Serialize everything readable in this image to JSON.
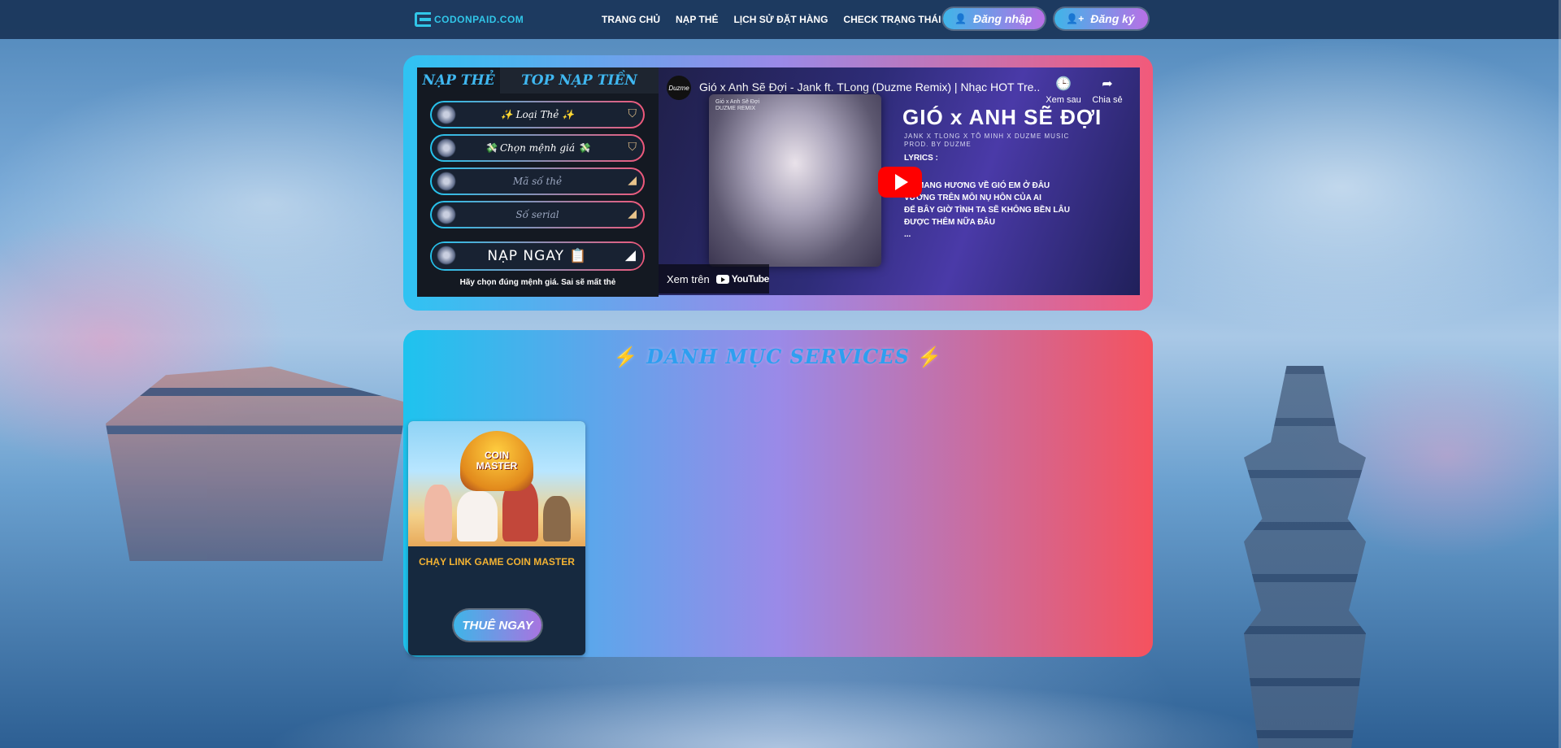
{
  "brand": {
    "logo_text": "CODONPAID.COM"
  },
  "nav": {
    "links": [
      "TRANG CHỦ",
      "NẠP THẺ",
      "LỊCH SỬ ĐẶT HÀNG",
      "CHECK TRẠNG THÁI LINK"
    ],
    "login_label": "Đăng nhập",
    "register_label": "Đăng ký"
  },
  "topup": {
    "tabs": [
      "NẠP THẺ",
      "TOP NẠP TIỀN"
    ],
    "card_type": "✨ Loại Thẻ ✨",
    "amount": "💸 Chọn mệnh giá 💸",
    "code_placeholder": "Mã số thẻ",
    "serial_placeholder": "Số serial",
    "submit_label": "NẠP NGAY 📋",
    "note": "Hãy chọn đúng mệnh giá. Sai sẽ mất thẻ"
  },
  "video": {
    "channel": "Duzme",
    "title": "Gió x Anh Sẽ Đợi - Jank ft. TLong (Duzme Remix) | Nhạc HOT Tre...",
    "watch_later": "Xem sau",
    "share": "Chia sẻ",
    "thumb_caption": [
      "Gió x Anh Sẽ Đợi",
      "DUZME REMIX"
    ],
    "song_title": "GIÓ x ANH SẼ ĐỢI",
    "credits": [
      "JANK X TLONG X TÔ MINH X DUZME MUSIC",
      "PROD. BY DUZME"
    ],
    "lyrics_label": "LYRICS :",
    "lyrics": [
      "MANG HƯƠNG VỀ GIÓ EM Ở ĐÂU",
      "VƯƠNG TRÊN MÔI NỤ HÔN CỦA AI",
      "ĐỂ BÂY GIỜ TÌNH TA SẼ KHÔNG BỀN LÂU",
      "ĐƯỢC THÊM NỮA ĐÂU",
      "..."
    ],
    "watch_on": "Xem trên",
    "youtube": "YouTube"
  },
  "services": {
    "title": "DANH MỤC SERVICES",
    "items": [
      {
        "name": "CHẠY LINK GAME COIN MASTER",
        "image_text": [
          "COIN",
          "MASTER"
        ],
        "button": "THUÊ NGAY"
      }
    ]
  },
  "colors": {
    "accent_cyan": "#2fc3f2",
    "accent_pink": "#f25a7a",
    "nav_bg": "#142d50",
    "gold": "#f2b233"
  }
}
